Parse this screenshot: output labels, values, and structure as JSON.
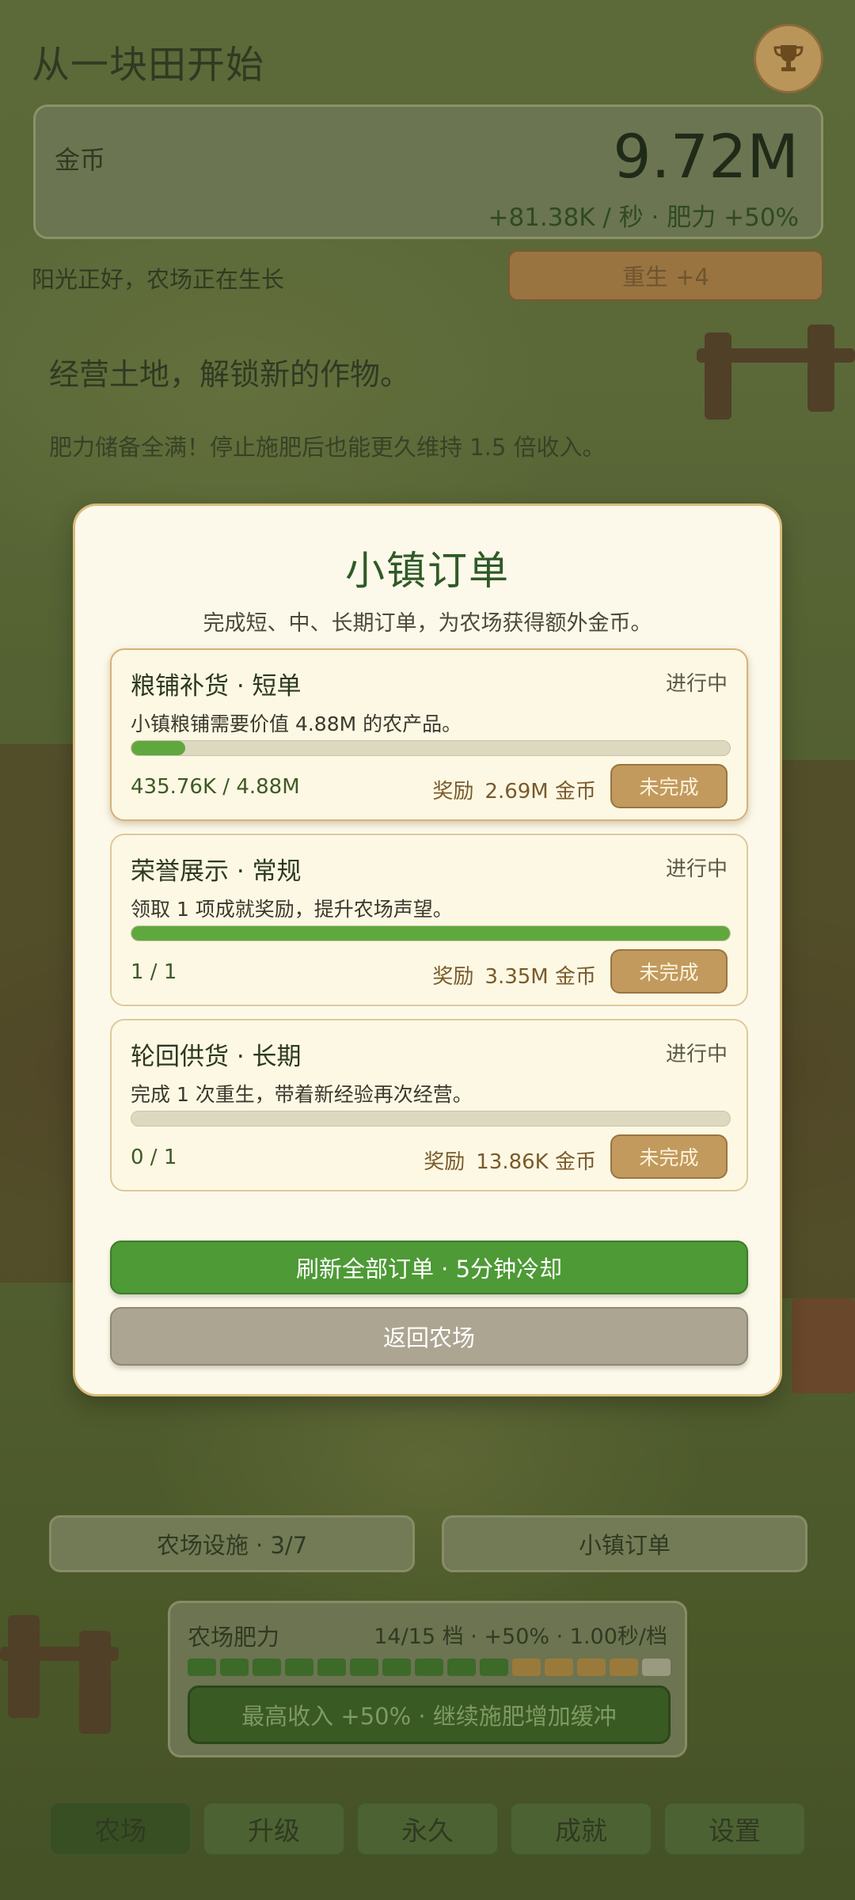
{
  "header": {
    "game_title": "从一块田开始",
    "trophy_icon": "trophy-icon"
  },
  "coins": {
    "label": "金币",
    "value": "9.72M",
    "rate": "+81.38K / 秒 · 肥力 +50%"
  },
  "status": {
    "text": "阳光正好，农场正在生长",
    "rebirth_label": "重生  +4"
  },
  "hints": {
    "headline": "经营土地，解锁新的作物。",
    "subline": "肥力储备全满！停止施肥后也能更久维持 1.5 倍收入。"
  },
  "modal": {
    "title": "小镇订单",
    "subtitle": "完成短、中、长期订单，为农场获得额外金币。",
    "orders": [
      {
        "name": "粮铺补货 · 短单",
        "status": "进行中",
        "desc": "小镇粮铺需要价值 4.88M 的农产品。",
        "progress_text": "435.76K / 4.88M",
        "progress": 0.0893,
        "reward_label": "奖励",
        "reward_amount": "2.69M 金币",
        "button": "未完成"
      },
      {
        "name": "荣誉展示 · 常规",
        "status": "进行中",
        "desc": "领取 1 项成就奖励，提升农场声望。",
        "progress_text": "1 / 1",
        "progress": 1.0,
        "reward_label": "奖励",
        "reward_amount": "3.35M 金币",
        "button": "未完成"
      },
      {
        "name": "轮回供货 · 长期",
        "status": "进行中",
        "desc": "完成 1 次重生，带着新经验再次经营。",
        "progress_text": "0 / 1",
        "progress": 0.0,
        "reward_label": "奖励",
        "reward_amount": "13.86K 金币",
        "button": "未完成"
      }
    ],
    "refresh_label": "刷新全部订单 · 5分钟冷却",
    "back_label": "返回农场"
  },
  "bottom": {
    "facilities_label": "农场设施 · 3/7",
    "orders_label": "小镇订单",
    "fertility": {
      "title": "农场肥力",
      "info": "14/15 档 · +50% · 1.00秒/档",
      "level": 14,
      "max": 15,
      "button": "最高收入 +50% · 继续施肥增加缓冲"
    }
  },
  "nav": {
    "items": [
      "农场",
      "升级",
      "永久",
      "成就",
      "设置"
    ],
    "active": 0
  },
  "colors": {
    "accent_green": "#4d9a36",
    "progress_green": "#5fa83d",
    "button_tan": "#c29a5e",
    "modal_bg": "#fdf9ea",
    "title_green": "#2f5a26"
  }
}
